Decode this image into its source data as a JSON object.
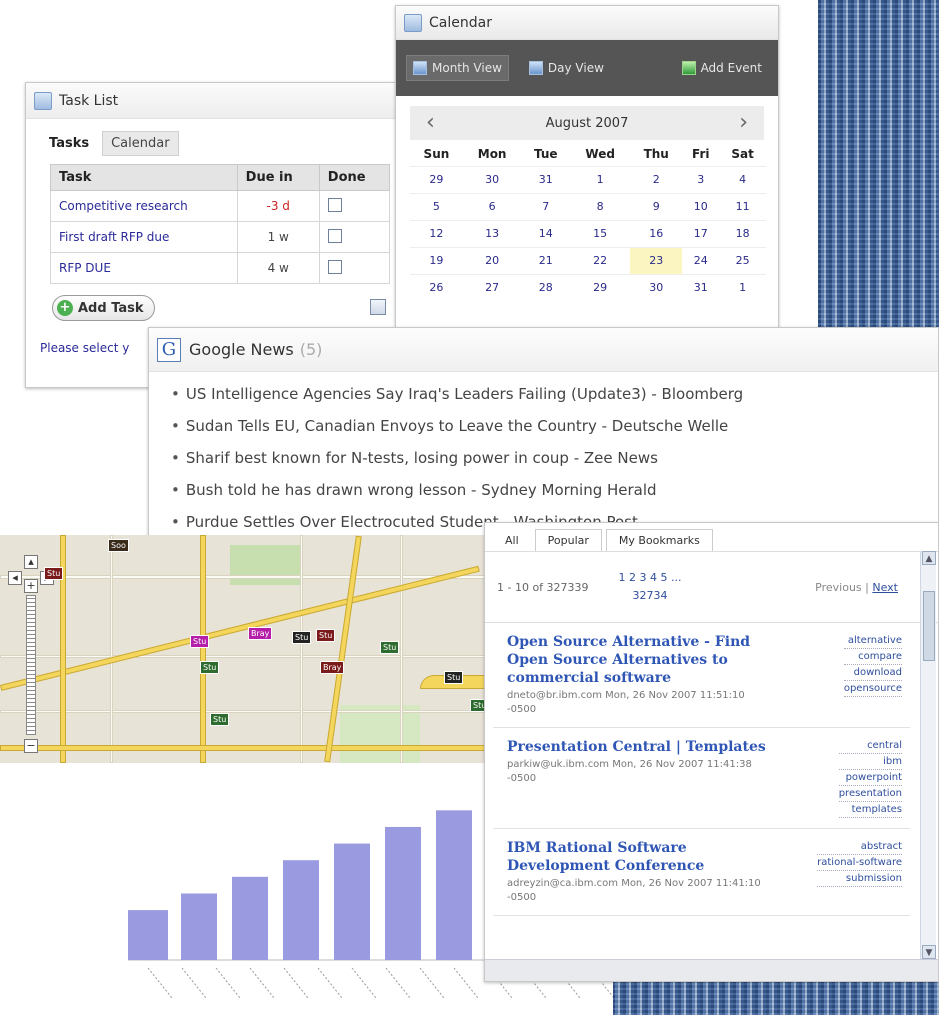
{
  "task_list": {
    "title": "Task List",
    "tabs": [
      "Tasks",
      "Calendar"
    ],
    "columns": [
      "Task",
      "Due in",
      "Done"
    ],
    "rows": [
      {
        "task": "Competitive research",
        "due": "-3 d",
        "overdue": true
      },
      {
        "task": "First draft RFP due",
        "due": "1 w",
        "overdue": false
      },
      {
        "task": "RFP DUE",
        "due": "4 w",
        "overdue": false
      }
    ],
    "add_label": "Add Task",
    "message": "Please select y"
  },
  "calendar": {
    "title": "Calendar",
    "toolbar": {
      "month": "Month View",
      "day": "Day View",
      "add": "Add Event"
    },
    "month_label": "August 2007",
    "weekdays": [
      "Sun",
      "Mon",
      "Tue",
      "Wed",
      "Thu",
      "Fri",
      "Sat"
    ],
    "weeks": [
      [
        "29",
        "30",
        "31",
        "1",
        "2",
        "3",
        "4"
      ],
      [
        "5",
        "6",
        "7",
        "8",
        "9",
        "10",
        "11"
      ],
      [
        "12",
        "13",
        "14",
        "15",
        "16",
        "17",
        "18"
      ],
      [
        "19",
        "20",
        "21",
        "22",
        "23",
        "24",
        "25"
      ],
      [
        "26",
        "27",
        "28",
        "29",
        "30",
        "31",
        "1"
      ]
    ],
    "today": "23"
  },
  "news": {
    "title": "Google News",
    "count": "(5)",
    "items": [
      "US Intelligence Agencies Say Iraq's Leaders Failing (Update3) - Bloomberg",
      "Sudan Tells EU, Canadian Envoys to Leave the Country - Deutsche Welle",
      "Sharif best known for N-tests, losing power in coup - Zee News",
      "Bush told he has drawn wrong lesson - Sydney Morning Herald",
      "Purdue Settles Over Electrocuted Student - Washington Post"
    ]
  },
  "bookmarks": {
    "tabs": [
      "All",
      "Popular",
      "My Bookmarks"
    ],
    "range": "1 - 10 of 327339",
    "pages": "1 2 3 4 5 ...",
    "last_page": "32734",
    "prev": "Previous",
    "next": "Next",
    "items": [
      {
        "title": "Open Source Alternative - Find Open Source Alternatives to commercial software",
        "meta": "dneto@br.ibm.com Mon, 26 Nov 2007 11:51:10 -0500",
        "tags": [
          "alternative",
          "compare",
          "download",
          "opensource"
        ]
      },
      {
        "title": "Presentation Central | Templates",
        "meta": "parkiw@uk.ibm.com Mon, 26 Nov 2007 11:41:38 -0500",
        "tags": [
          "central",
          "ibm",
          "powerpoint",
          "presentation",
          "templates"
        ]
      },
      {
        "title": "IBM Rational Software Development Conference",
        "meta": "adreyzin@ca.ibm.com Mon, 26 Nov 2007 11:41:10 -0500",
        "tags": [
          "abstract",
          "rational-software",
          "submission"
        ]
      }
    ]
  },
  "map": {
    "markers": [
      "Soo",
      "Stu",
      "Stu",
      "Bray",
      "Stu",
      "Stu",
      "Bray",
      "Stu",
      "Stu",
      "Stu",
      "Stu",
      "Stu"
    ]
  },
  "chart_data": {
    "type": "bar",
    "values": [
      3,
      4,
      5,
      6,
      7,
      8,
      9
    ],
    "ylim": [
      0,
      10
    ],
    "color": "#9a9ae0"
  }
}
